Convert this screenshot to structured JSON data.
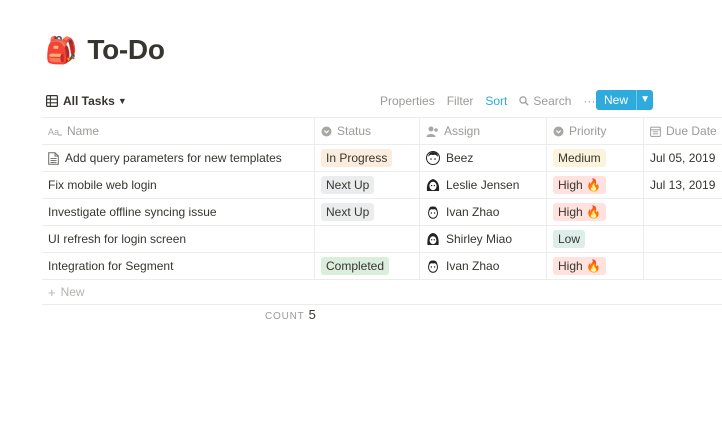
{
  "page": {
    "icon": "🎒",
    "title": "To-Do"
  },
  "view": {
    "name": "All Tasks",
    "toolbar": {
      "properties": "Properties",
      "filter": "Filter",
      "sort": "Sort",
      "search": "Search",
      "more": "···",
      "new": "New"
    }
  },
  "columns": {
    "name": "Name",
    "status": "Status",
    "assign": "Assign",
    "priority": "Priority",
    "due": "Due Date"
  },
  "rows": [
    {
      "name": "Add query parameters for new templates",
      "has_doc_icon": true,
      "status": "In Progress",
      "assignee": "Beez",
      "priority": "Medium",
      "due": "Jul 05, 2019"
    },
    {
      "name": "Fix mobile web login",
      "has_doc_icon": false,
      "status": "Next Up",
      "assignee": "Leslie Jensen",
      "priority": "High 🔥",
      "due": "Jul 13, 2019"
    },
    {
      "name": "Investigate offline syncing issue",
      "has_doc_icon": false,
      "status": "Next Up",
      "assignee": "Ivan Zhao",
      "priority": "High 🔥",
      "due": ""
    },
    {
      "name": "UI refresh for login screen",
      "has_doc_icon": false,
      "status": "",
      "assignee": "Shirley Miao",
      "priority": "Low",
      "due": ""
    },
    {
      "name": "Integration for Segment",
      "has_doc_icon": false,
      "status": "Completed",
      "assignee": "Ivan Zhao",
      "priority": "High 🔥",
      "due": ""
    }
  ],
  "new_row_label": "New",
  "footer": {
    "count_label": "COUNT",
    "count_value": "5"
  },
  "colors": {
    "accent": "#2eaadc",
    "status": {
      "In Progress": "#fbecdd",
      "Next Up": "#ebeced",
      "Completed": "#dbeddb"
    },
    "priority": {
      "Medium": "#fbf3db",
      "High 🔥": "#ffe2dd",
      "Low": "#ddedea"
    }
  }
}
